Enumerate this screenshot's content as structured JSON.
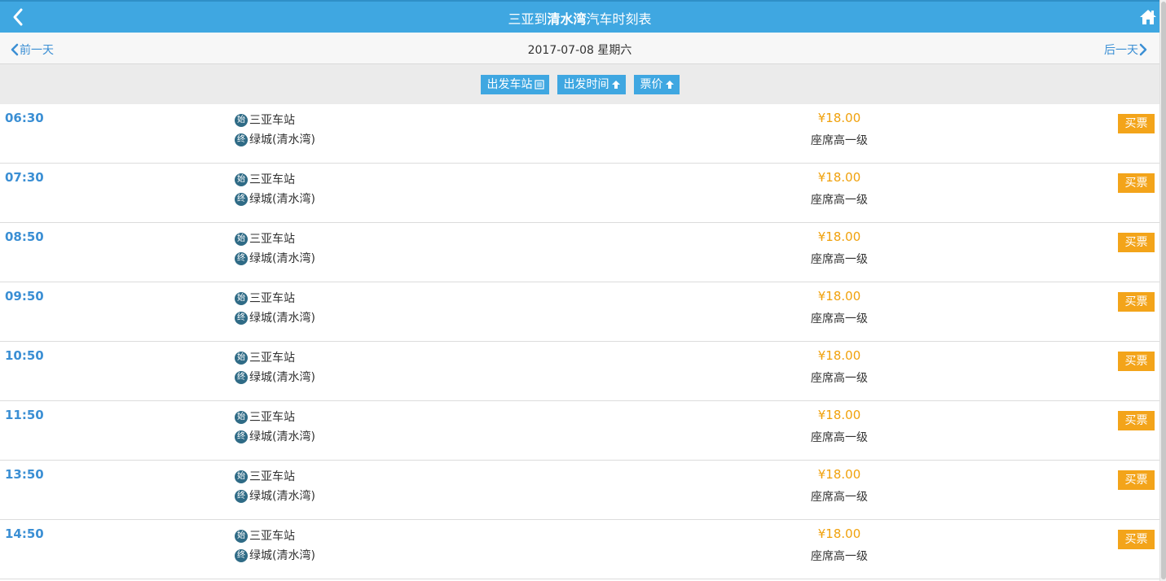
{
  "header": {
    "title_origin": "三亚",
    "title_mid": "到",
    "title_destination": "清水湾",
    "title_suffix": "汽车时刻表",
    "back_icon": "chevron-left-icon",
    "home_icon": "home-icon",
    "bar_color": "#3fa7e1"
  },
  "datebar": {
    "prev_label": "前一天",
    "date": "2017-07-08 星期六",
    "next_label": "后一天"
  },
  "sort": {
    "station_label": "出发车站",
    "time_label": "出发时间",
    "price_label": "票价"
  },
  "trips": [
    {
      "time": "06:30",
      "start_badge": "始",
      "start": "三亚车站",
      "end_badge": "终",
      "end": "绿城(清水湾)",
      "price": "¥18.00",
      "seat": "座席高一级",
      "buy": "买票"
    },
    {
      "time": "07:30",
      "start_badge": "始",
      "start": "三亚车站",
      "end_badge": "终",
      "end": "绿城(清水湾)",
      "price": "¥18.00",
      "seat": "座席高一级",
      "buy": "买票"
    },
    {
      "time": "08:50",
      "start_badge": "始",
      "start": "三亚车站",
      "end_badge": "终",
      "end": "绿城(清水湾)",
      "price": "¥18.00",
      "seat": "座席高一级",
      "buy": "买票"
    },
    {
      "time": "09:50",
      "start_badge": "始",
      "start": "三亚车站",
      "end_badge": "终",
      "end": "绿城(清水湾)",
      "price": "¥18.00",
      "seat": "座席高一级",
      "buy": "买票"
    },
    {
      "time": "10:50",
      "start_badge": "始",
      "start": "三亚车站",
      "end_badge": "终",
      "end": "绿城(清水湾)",
      "price": "¥18.00",
      "seat": "座席高一级",
      "buy": "买票"
    },
    {
      "time": "11:50",
      "start_badge": "始",
      "start": "三亚车站",
      "end_badge": "终",
      "end": "绿城(清水湾)",
      "price": "¥18.00",
      "seat": "座席高一级",
      "buy": "买票"
    },
    {
      "time": "13:50",
      "start_badge": "始",
      "start": "三亚车站",
      "end_badge": "终",
      "end": "绿城(清水湾)",
      "price": "¥18.00",
      "seat": "座席高一级",
      "buy": "买票"
    },
    {
      "time": "14:50",
      "start_badge": "始",
      "start": "三亚车站",
      "end_badge": "终",
      "end": "绿城(清水湾)",
      "price": "¥18.00",
      "seat": "座席高一级",
      "buy": "买票"
    }
  ],
  "colors": {
    "accent": "#3fa7e1",
    "price": "#f0a10c",
    "buy_button": "#f3a41a",
    "time": "#3b8fd4"
  }
}
